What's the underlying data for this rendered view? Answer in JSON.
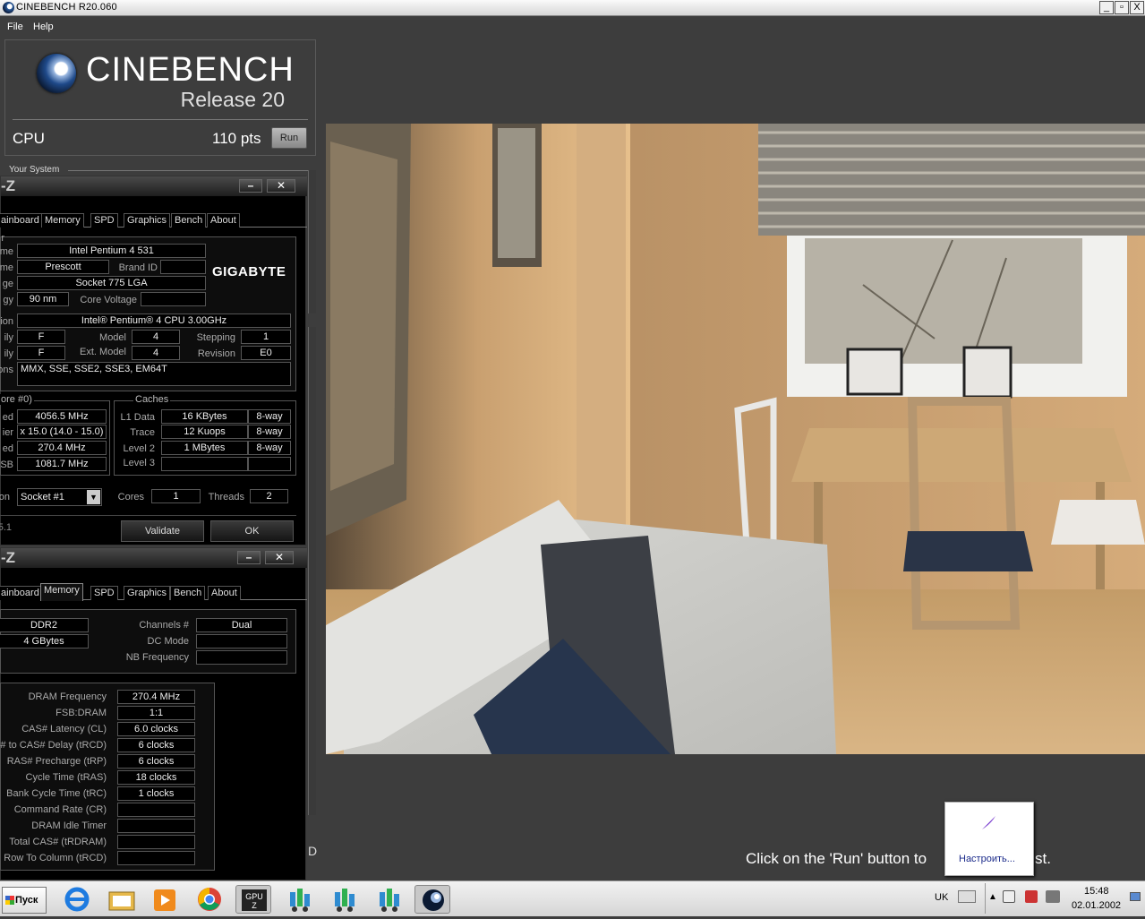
{
  "window": {
    "title": "CINEBENCH R20.060",
    "min": "_",
    "max": "▫",
    "close": "X"
  },
  "menu": {
    "file": "File",
    "help": "Help"
  },
  "cinebench": {
    "brand": "CINEBENCH",
    "release": "Release 20",
    "cpu_label": "CPU",
    "score": "110 pts",
    "run_label": "Run",
    "your_system": "Your System",
    "hint": "Click on the 'Run' button to",
    "hint_tail": "st.",
    "d_mark": "D"
  },
  "cpuz1": {
    "title": "-Z",
    "tabs": [
      "ainboard",
      "Memory",
      "SPD",
      "Graphics",
      "Bench",
      "About"
    ],
    "labels": {
      "name": "e",
      "code": "me",
      "package": "ge",
      "tech": "gy",
      "spec": "ion",
      "family": "ily",
      "ext_family": "ily",
      "instr": "ons",
      "clocks": "ore #0)",
      "speed": "ed",
      "mult": "ier",
      "bus": "ed",
      "fsb": "SB",
      "sel": "on",
      "ver": "5.1"
    },
    "name": "Intel Pentium 4 531",
    "codename": "Prescott",
    "brand_id_label": "Brand ID",
    "package": "Socket 775 LGA",
    "technology": "90 nm",
    "core_voltage_label": "Core Voltage",
    "vendor_logo": "GIGABYTE",
    "specification": "Intel® Pentium® 4 CPU 3.00GHz",
    "family": "F",
    "model_label": "Model",
    "model": "4",
    "stepping_label": "Stepping",
    "stepping": "1",
    "ext_family": "F",
    "ext_model_label": "Ext. Model",
    "ext_model": "4",
    "revision_label": "Revision",
    "revision": "E0",
    "instructions": "MMX, SSE, SSE2, SSE3, EM64T",
    "core_speed": "4056.5 MHz",
    "multiplier": "x 15.0 (14.0 - 15.0)",
    "bus_speed": "270.4 MHz",
    "rated_fsb": "1081.7 MHz",
    "caches_label": "Caches",
    "cache_rows": [
      {
        "label": "L1 Data",
        "size": "16 KBytes",
        "way": "8-way"
      },
      {
        "label": "Trace",
        "size": "12 Kuops",
        "way": "8-way"
      },
      {
        "label": "Level 2",
        "size": "1 MBytes",
        "way": "8-way"
      },
      {
        "label": "Level 3",
        "size": "",
        "way": ""
      }
    ],
    "socket": "Socket #1",
    "cores_label": "Cores",
    "cores": "1",
    "threads_label": "Threads",
    "threads": "2",
    "validate": "Validate",
    "ok": "OK"
  },
  "cpuz2": {
    "title": "-Z",
    "tabs": [
      "ainboard",
      "Memory",
      "SPD",
      "Graphics",
      "Bench",
      "About"
    ],
    "type": "DDR2",
    "size": "4 GBytes",
    "channels_label": "Channels #",
    "channels": "Dual",
    "dc_mode_label": "DC Mode",
    "nb_freq_label": "NB Frequency",
    "timings": [
      {
        "label": "DRAM Frequency",
        "value": "270.4 MHz"
      },
      {
        "label": "FSB:DRAM",
        "value": "1:1"
      },
      {
        "label": "CAS# Latency (CL)",
        "value": "6.0 clocks"
      },
      {
        "label": "# to CAS# Delay (tRCD)",
        "value": "6 clocks"
      },
      {
        "label": "RAS# Precharge (tRP)",
        "value": "6 clocks"
      },
      {
        "label": "Cycle Time (tRAS)",
        "value": "18 clocks"
      },
      {
        "label": "Bank Cycle Time (tRC)",
        "value": "1 clocks"
      },
      {
        "label": "Command Rate (CR)",
        "value": ""
      },
      {
        "label": "DRAM Idle Timer",
        "value": ""
      },
      {
        "label": "Total CAS# (tRDRAM)",
        "value": ""
      },
      {
        "label": "Row To Column (tRCD)",
        "value": ""
      }
    ]
  },
  "taskbar": {
    "start": "Пуск",
    "lang": "UK",
    "time": "15:48",
    "date": "02.01.2002",
    "icons": [
      "ie-icon",
      "explorer-icon",
      "media-player-icon",
      "chrome-icon",
      "gpu-z-icon",
      "cpu-z-icon-1",
      "cpu-z-icon-2",
      "cpu-z-icon-3",
      "cinebench-icon"
    ]
  },
  "popup": {
    "text": "Настроить..."
  }
}
